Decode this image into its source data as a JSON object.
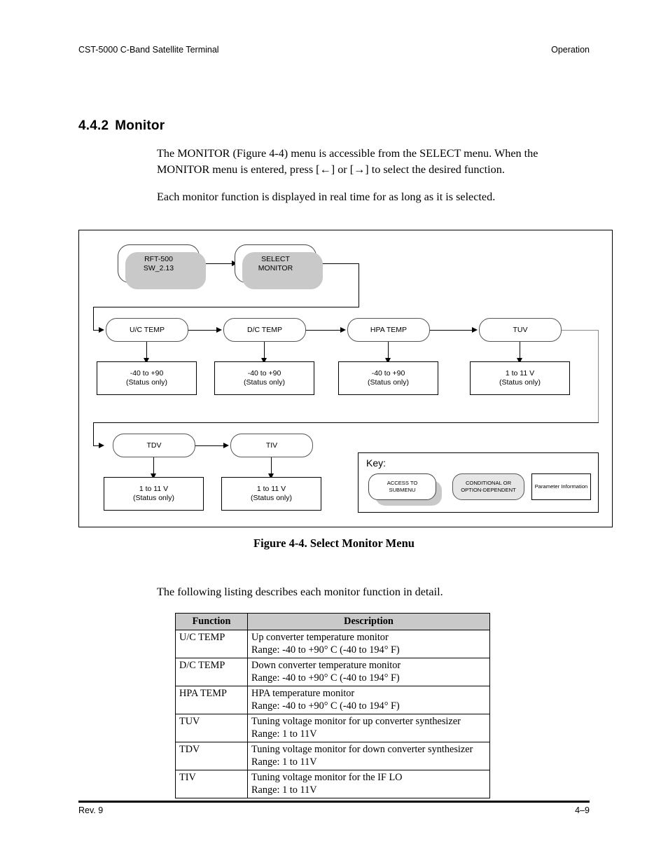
{
  "running_head": {
    "left": "CST-5000 C-Band Satellite Terminal",
    "right": "Operation"
  },
  "section": {
    "number": "4.4.2",
    "title": "Monitor"
  },
  "paragraphs": {
    "p1": "The MONITOR (Figure 4-4) menu is accessible from the SELECT menu. When the MONITOR menu is entered, press [←] or [→] to select the desired function.",
    "p2": "Each monitor function is displayed in real time for as long as it is selected.",
    "p3": "The following listing describes each monitor function in detail."
  },
  "figure": {
    "caption": "Figure 4-4.  Select Monitor Menu",
    "nodes": {
      "root_line1": "RFT-500",
      "root_line2": "SW_2.13",
      "select_line1": "SELECT",
      "select_line2": "MONITOR"
    },
    "functions": [
      {
        "name": "U/C TEMP",
        "range": "-40 to +90",
        "status": "(Status only)"
      },
      {
        "name": "D/C TEMP",
        "range": "-40 to +90",
        "status": "(Status only)"
      },
      {
        "name": "HPA TEMP",
        "range": "-40 to +90",
        "status": "(Status only)"
      },
      {
        "name": "TUV",
        "range": "1 to 11 V",
        "status": "(Status only)"
      },
      {
        "name": "TDV",
        "range": "1 to 11 V",
        "status": "(Status only)"
      },
      {
        "name": "TIV",
        "range": "1 to 11 V",
        "status": "(Status only)"
      }
    ],
    "key": {
      "label": "Key:",
      "items": [
        {
          "line1": "ACCESS TO",
          "line2": "SUBMENU"
        },
        {
          "line1": "CONDITIONAL OR",
          "line2": "OPTION-DEPENDENT"
        },
        {
          "line1": "Parameter Information",
          "line2": ""
        }
      ]
    }
  },
  "table": {
    "headers": [
      "Function",
      "Description"
    ],
    "rows": [
      {
        "function": "U/C TEMP",
        "desc1": "Up converter temperature monitor",
        "desc2": "Range: -40 to +90° C (-40 to 194° F)"
      },
      {
        "function": "D/C TEMP",
        "desc1": "Down converter temperature monitor",
        "desc2": "Range: -40 to +90° C (-40 to 194° F)"
      },
      {
        "function": "HPA TEMP",
        "desc1": "HPA temperature monitor",
        "desc2": "Range: -40 to +90° C (-40 to 194° F)"
      },
      {
        "function": "TUV",
        "desc1": "Tuning voltage monitor for up converter synthesizer",
        "desc2": "Range: 1 to 11V"
      },
      {
        "function": "TDV",
        "desc1": "Tuning voltage monitor for down converter synthesizer",
        "desc2": "Range: 1 to 11V"
      },
      {
        "function": "TIV",
        "desc1": "Tuning voltage monitor for the IF LO",
        "desc2": "Range: 1 to 11V"
      }
    ]
  },
  "footer": {
    "left": "Rev. 9",
    "right": "4–9"
  }
}
